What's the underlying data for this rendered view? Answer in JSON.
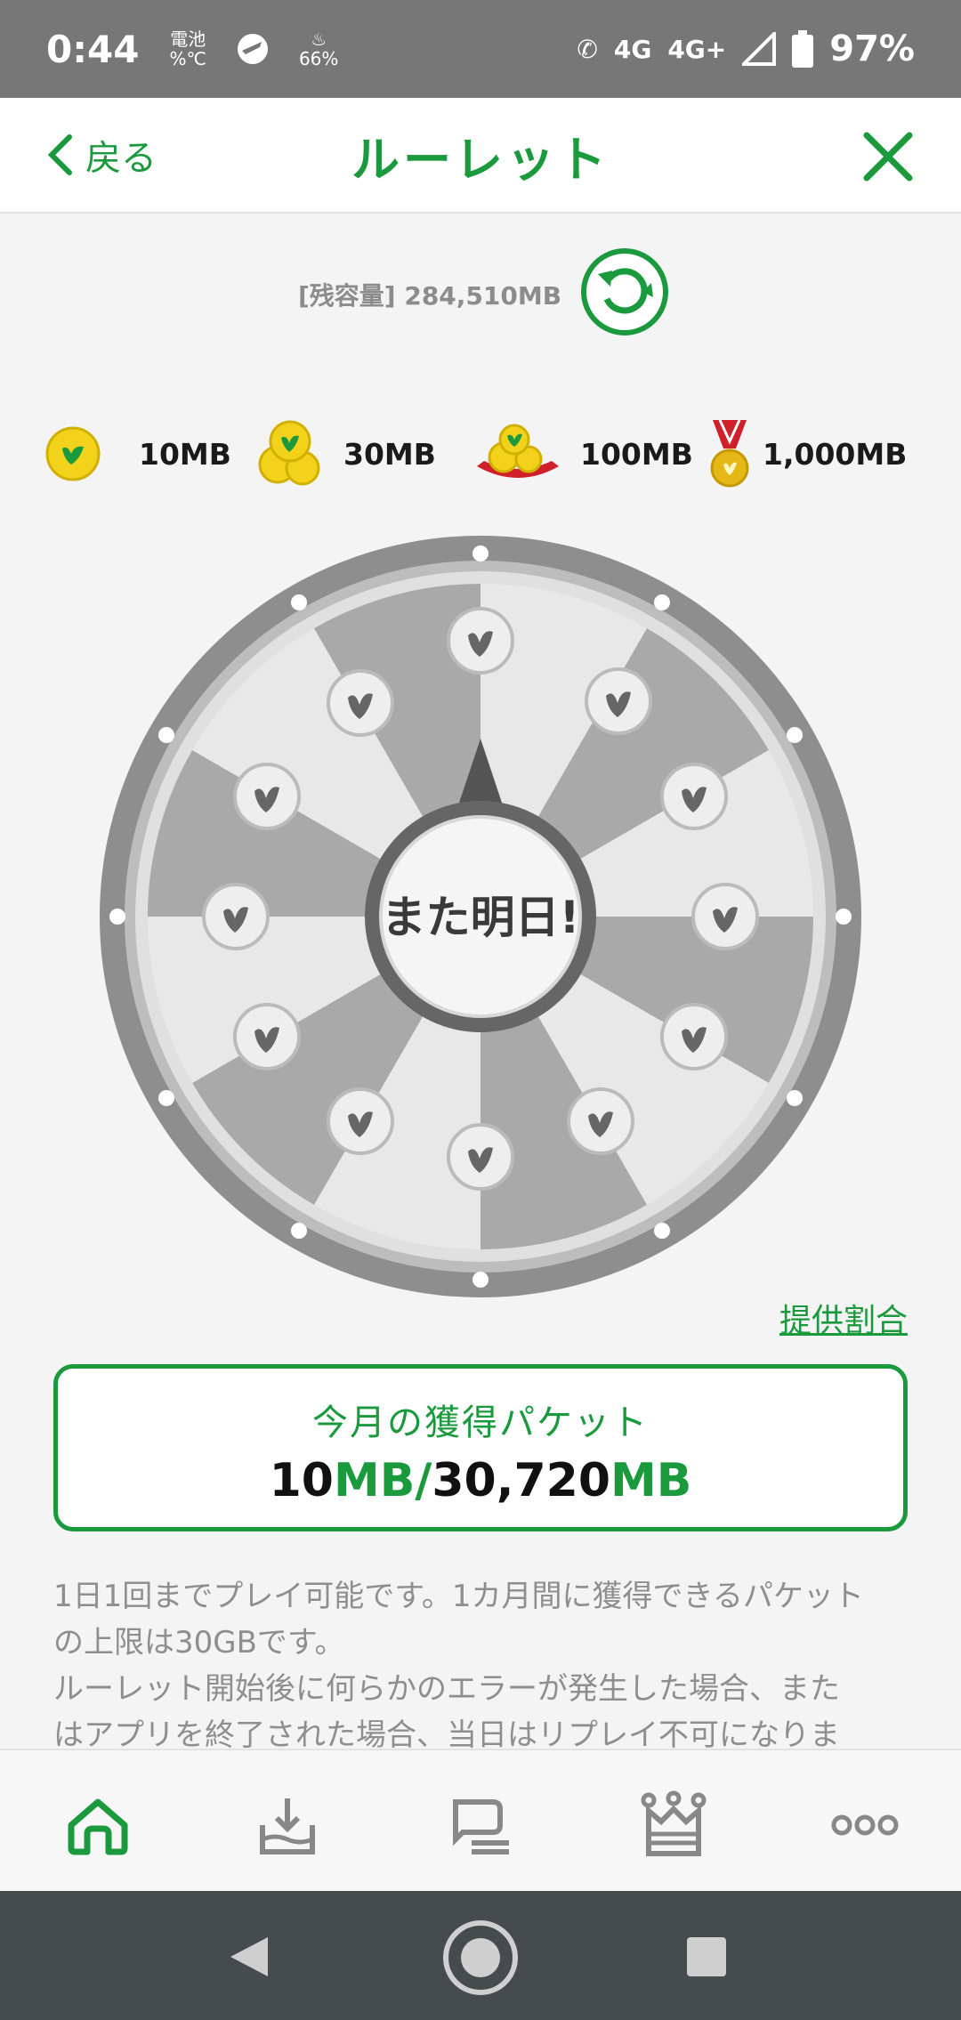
{
  "status_bar": {
    "time": "0:44",
    "battery_label_top": "電池",
    "battery_label_bottom": "%℃",
    "mini_pct": "66%",
    "network_1": "4G",
    "network_2": "4G+",
    "battery_percent": "97%"
  },
  "header": {
    "back_label": "戻る",
    "title": "ルーレット"
  },
  "remaining": {
    "text": "[残容量] 284,510MB"
  },
  "prizes": [
    {
      "label": "10MB"
    },
    {
      "label": "30MB"
    },
    {
      "label": "100MB"
    },
    {
      "label": "1,000MB"
    }
  ],
  "wheel": {
    "center_label": "また明日!"
  },
  "provide_link": "提供割合",
  "packet": {
    "title": "今月の獲得パケット",
    "value_earned": "10",
    "unit_1": "MB/",
    "value_limit": "30,720",
    "unit_2": "MB"
  },
  "notes": [
    "1日1回までプレイ可能です。1カ月間に獲得できるパケット",
    "の上限は30GBです。",
    "ルーレット開始後に何らかのエラーが発生した場合、また",
    "はアプリを終了された場合、当日はリプレイ不可になりま"
  ],
  "colors": {
    "accent": "#1a9a3c",
    "coin": "#f2d21a",
    "status_bar": "#777777"
  }
}
